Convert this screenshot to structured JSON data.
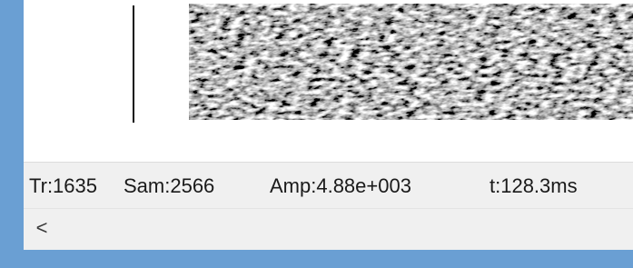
{
  "status": {
    "trace": "Tr:1635",
    "sample": "Sam:2566",
    "amplitude": "Amp:4.88e+003",
    "time": "t:128.3ms"
  },
  "scrollbar": {
    "left_arrow": "<"
  },
  "colors": {
    "window_frame": "#6a9fd3",
    "status_bar_bg": "#f0f0f0",
    "plot_bg": "#ffffff"
  },
  "icons": {
    "scroll_left": "chevron-left-icon"
  }
}
